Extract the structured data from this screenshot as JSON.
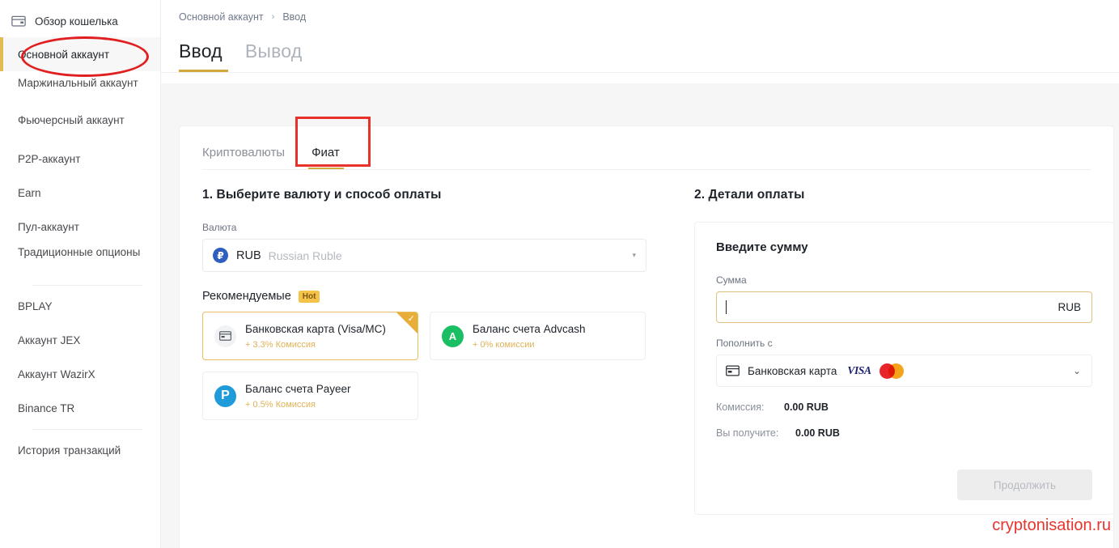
{
  "sidebar": {
    "top": {
      "label": "Обзор кошелька",
      "icon": "wallet-icon"
    },
    "items": [
      {
        "label": "Основной аккаунт",
        "active": true
      },
      {
        "label": "Маржинальный аккаунт",
        "two_line": true
      },
      {
        "label": "Фьючерсный аккаунт",
        "two_line": true
      },
      {
        "label": "P2P-аккаунт"
      },
      {
        "label": "Earn"
      },
      {
        "label": "Пул-аккаунт"
      },
      {
        "label": "Традиционные опционы",
        "two_line": true
      },
      {
        "label": "BPLAY"
      },
      {
        "label": "Аккаунт JEX"
      },
      {
        "label": "Аккаунт WazirX"
      },
      {
        "label": "Binance TR"
      },
      {
        "label": "История транзакций"
      }
    ]
  },
  "breadcrumb": {
    "parent": "Основной аккаунт",
    "separator": "›",
    "current": "Ввод"
  },
  "main_tabs": [
    {
      "label": "Ввод",
      "active": true
    },
    {
      "label": "Вывод",
      "active": false
    }
  ],
  "inner_tabs": [
    {
      "label": "Криптовалюты",
      "active": false
    },
    {
      "label": "Фиат",
      "active": true
    }
  ],
  "left": {
    "heading": "1. Выберите валюту и способ оплаты",
    "currency_label": "Валюта",
    "currency": {
      "icon": "ruble-icon",
      "code": "RUB",
      "name": "Russian Ruble",
      "caret": "▾"
    },
    "recommended_title": "Рекомендуемые",
    "hot_badge": "Hot",
    "methods": [
      {
        "icon": "bank-card-icon",
        "name": "Банковская карта (Visa/MC)",
        "fee": "+ 3.3% Комиссия",
        "selected": true,
        "check": "✓"
      },
      {
        "icon": "advcash-icon",
        "name": "Баланс счета Advcash",
        "fee": "+ 0% комиссии",
        "selected": false
      },
      {
        "icon": "payeer-icon",
        "name": "Баланс счета Payeer",
        "fee": "+ 0.5% Комиссия",
        "selected": false
      }
    ]
  },
  "right": {
    "heading": "2. Детали оплаты",
    "box_title": "Введите сумму",
    "amount_label": "Сумма",
    "amount_value": "",
    "amount_currency": "RUB",
    "topup_label": "Пополнить с",
    "topup_value": "Банковская карта",
    "topup_caret": "⌄",
    "card_brands": [
      "VISA",
      "Mastercard"
    ],
    "fee_label": "Комиссия:",
    "fee_value": "0.00 RUB",
    "receive_label": "Вы получите:",
    "receive_value": "0.00 RUB",
    "continue_button": "Продолжить"
  },
  "watermark": "cryptonisation.ru",
  "colors": {
    "accent_gold": "#d2a83c",
    "sidebar_accent": "#e3bb55",
    "annotation_red": "#e8312a",
    "fee_text": "#e0b256",
    "watermark_red": "#e8342c"
  }
}
